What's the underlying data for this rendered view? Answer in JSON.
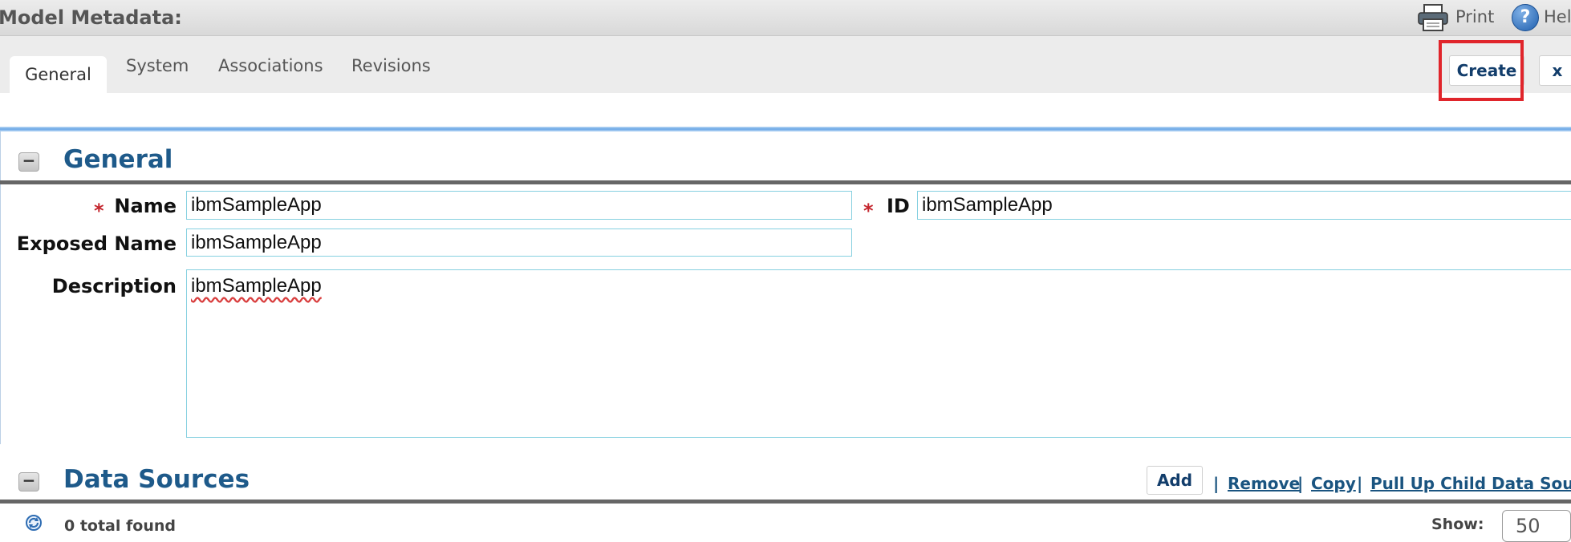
{
  "header": {
    "title": "Model Metadata:",
    "print_label": "Print",
    "help_label": "Help"
  },
  "tabs": [
    {
      "label": "General",
      "active": true
    },
    {
      "label": "System",
      "active": false
    },
    {
      "label": "Associations",
      "active": false
    },
    {
      "label": "Revisions",
      "active": false
    }
  ],
  "actions": {
    "create_label": "Create",
    "close_label": "x"
  },
  "general_section": {
    "title": "General",
    "collapse_symbol": "−",
    "required_marker": "*",
    "name_label": "Name",
    "name_value": "ibmSampleApp",
    "id_label": "ID",
    "id_value": "ibmSampleApp",
    "exposed_name_label": "Exposed Name",
    "exposed_name_value": "ibmSampleApp",
    "description_label": "Description",
    "description_value": "ibmSampleApp"
  },
  "data_sources_section": {
    "title": "Data Sources",
    "collapse_symbol": "−",
    "add_label": "Add",
    "separator": "|",
    "remove_label": "Remove",
    "copy_label": "Copy",
    "pull_up_label": "Pull Up Child Data Sources",
    "total_found": "0 total found",
    "show_label": "Show:",
    "page_size": "50"
  },
  "colors": {
    "accent": "#1e5a8a",
    "highlight": "#e0252b",
    "required": "#c4262e"
  },
  "icons": [
    "print-icon",
    "help-icon",
    "refresh-icon",
    "collapse-icon"
  ]
}
